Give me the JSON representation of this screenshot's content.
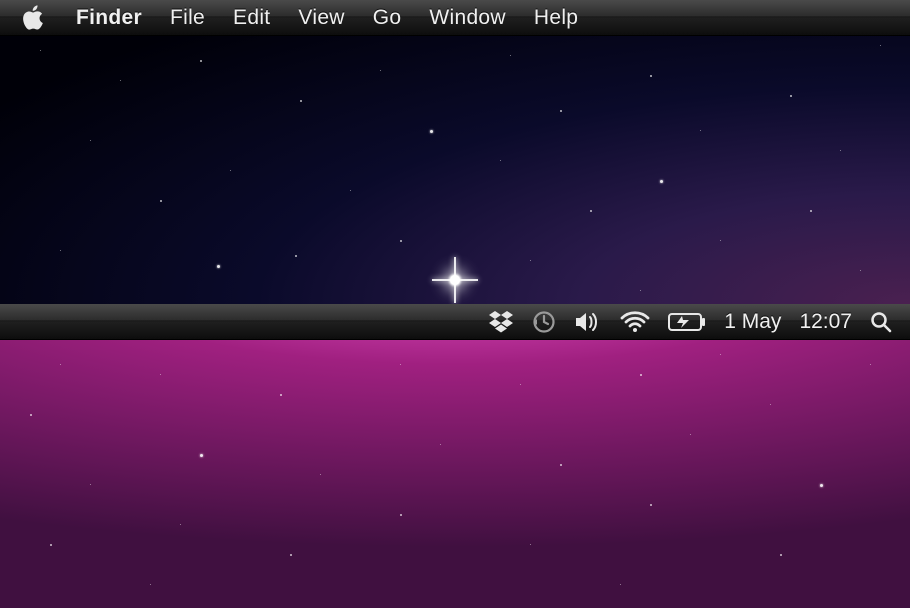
{
  "menubar": {
    "app_name": "Finder",
    "items": [
      "File",
      "Edit",
      "View",
      "Go",
      "Window",
      "Help"
    ]
  },
  "status": {
    "date": "1 May",
    "time": "12:07",
    "icons": {
      "dropbox": "dropbox-icon",
      "timemachine": "timemachine-icon",
      "volume": "volume-icon",
      "wifi": "wifi-icon",
      "battery": "battery-charging-icon",
      "spotlight": "spotlight-icon"
    }
  }
}
